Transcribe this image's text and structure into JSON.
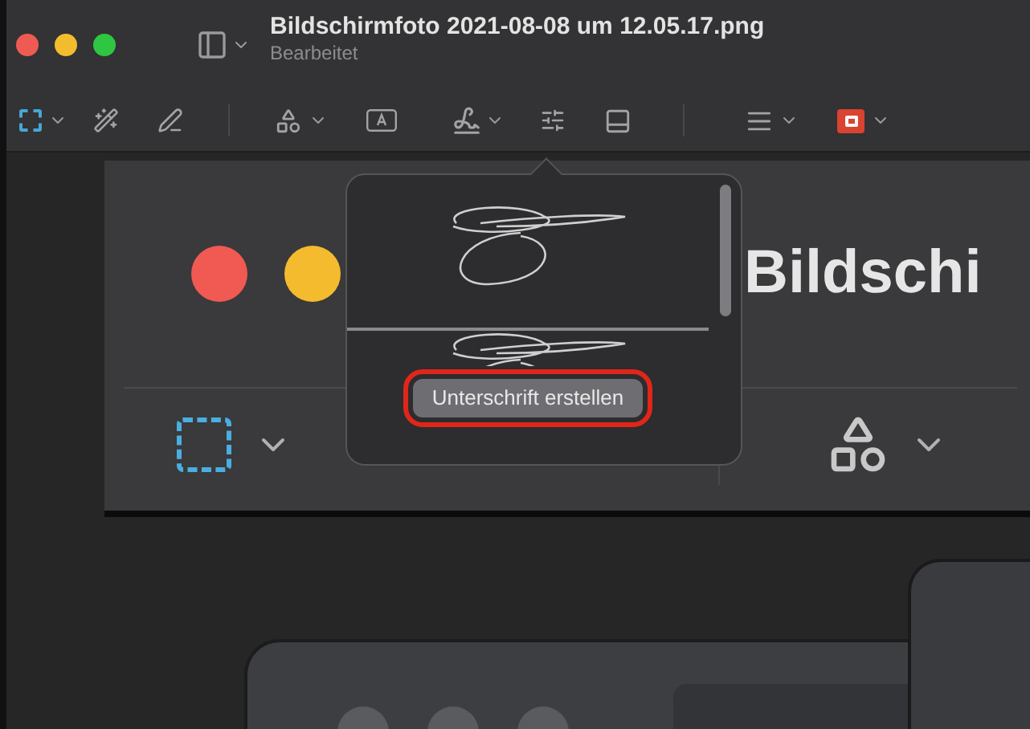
{
  "window": {
    "title": "Bildschirmfoto 2021-08-08 um 12.05.17.png",
    "subtitle": "Bearbeitet"
  },
  "embedded_screenshot": {
    "title_fragment": "Bildschi"
  },
  "signature_popover": {
    "button": {
      "label": "Unterschrift erstellen",
      "circled": true
    }
  }
}
